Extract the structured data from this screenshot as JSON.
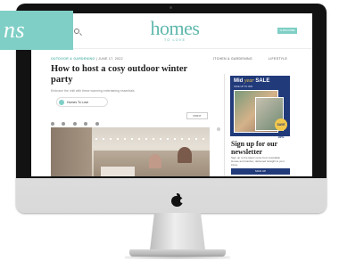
{
  "tag": {
    "text": "ns"
  },
  "site": {
    "logo": "homes",
    "logo_sub": "TO LOVE",
    "subscribe_label": "SUBSCRIBE",
    "nav": [
      "ITCHEN & GARDENING",
      "LIFESTYLE"
    ]
  },
  "article": {
    "category": "OUTDOOR & GARDENING",
    "separator": "|",
    "date": "JUNE 17, 2022",
    "title": "How to host a cosy outdoor winter party",
    "subtitle": "Embrace the chill with these warming entertaining essentials",
    "author": "Homes To Love",
    "print_label": "PRINT"
  },
  "sidebar": {
    "ad_title_prefix": "Mid ",
    "ad_title_italic": "year",
    "ad_title_suffix": " SALE",
    "ad_subtitle": "SAVE UP TO 39%",
    "ad_badge": "SAVE 39%",
    "newsletter_title": "Sign up for our newsletter",
    "newsletter_desc": "Sign up to the latest news from Australian House and Garden, delivered straight to your inbox.",
    "signup_label": "SIGN UP"
  }
}
